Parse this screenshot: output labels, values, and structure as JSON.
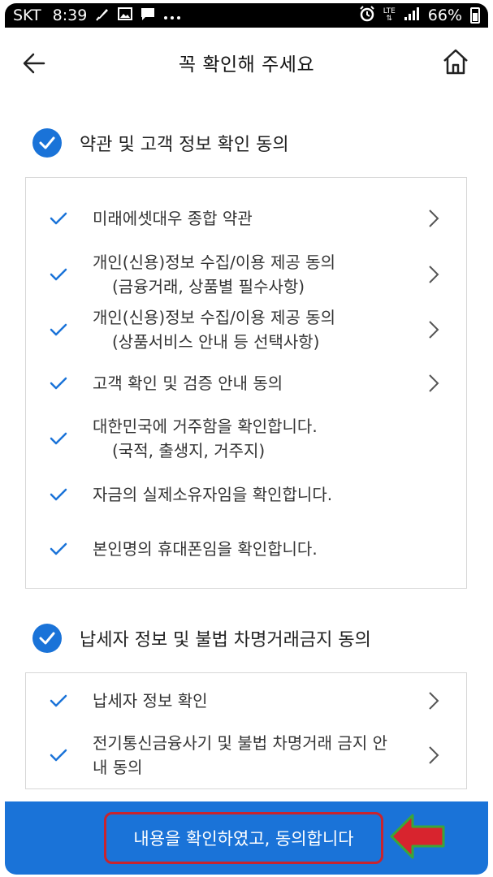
{
  "status_bar": {
    "carrier": "SKT",
    "time": "8:39",
    "network": "LTE",
    "battery": "66%"
  },
  "header": {
    "title": "꼭 확인해 주세요"
  },
  "sections": [
    {
      "title": "약관 및 고객 정보 확인 동의",
      "items": [
        {
          "line1": "미래에셋대우 종합 약관",
          "line2": "",
          "has_chevron": true
        },
        {
          "line1": "개인(신용)정보 수집/이용 제공 동의",
          "line2": "(금융거래, 상품별 필수사항)",
          "has_chevron": true
        },
        {
          "line1": "개인(신용)정보 수집/이용 제공 동의",
          "line2": "(상품서비스 안내 등 선택사항)",
          "has_chevron": true
        },
        {
          "line1": "고객 확인 및 검증 안내 동의",
          "line2": "",
          "has_chevron": true
        },
        {
          "line1": "대한민국에 거주함을 확인합니다.",
          "line2": "(국적, 출생지, 거주지)",
          "has_chevron": false
        },
        {
          "line1": "자금의 실제소유자임을 확인합니다.",
          "line2": "",
          "has_chevron": false
        },
        {
          "line1": "본인명의 휴대폰임을 확인합니다.",
          "line2": "",
          "has_chevron": false
        }
      ]
    },
    {
      "title": "납세자 정보 및 불법 차명거래금지 동의",
      "items": [
        {
          "line1": "납세자 정보 확인",
          "line2": "",
          "has_chevron": true
        },
        {
          "line1": "전기통신금융사기 및 불법 차명거래 금지 안",
          "line2": "내 동의",
          "has_chevron": true
        }
      ]
    }
  ],
  "bottom": {
    "confirm_label": "내용을 확인하였고, 동의합니다"
  },
  "colors": {
    "accent": "#1a73d8",
    "annotation_border": "#c8242e",
    "annotation_arrow_fill": "#d8242e",
    "annotation_arrow_outline": "#3aa63a"
  }
}
